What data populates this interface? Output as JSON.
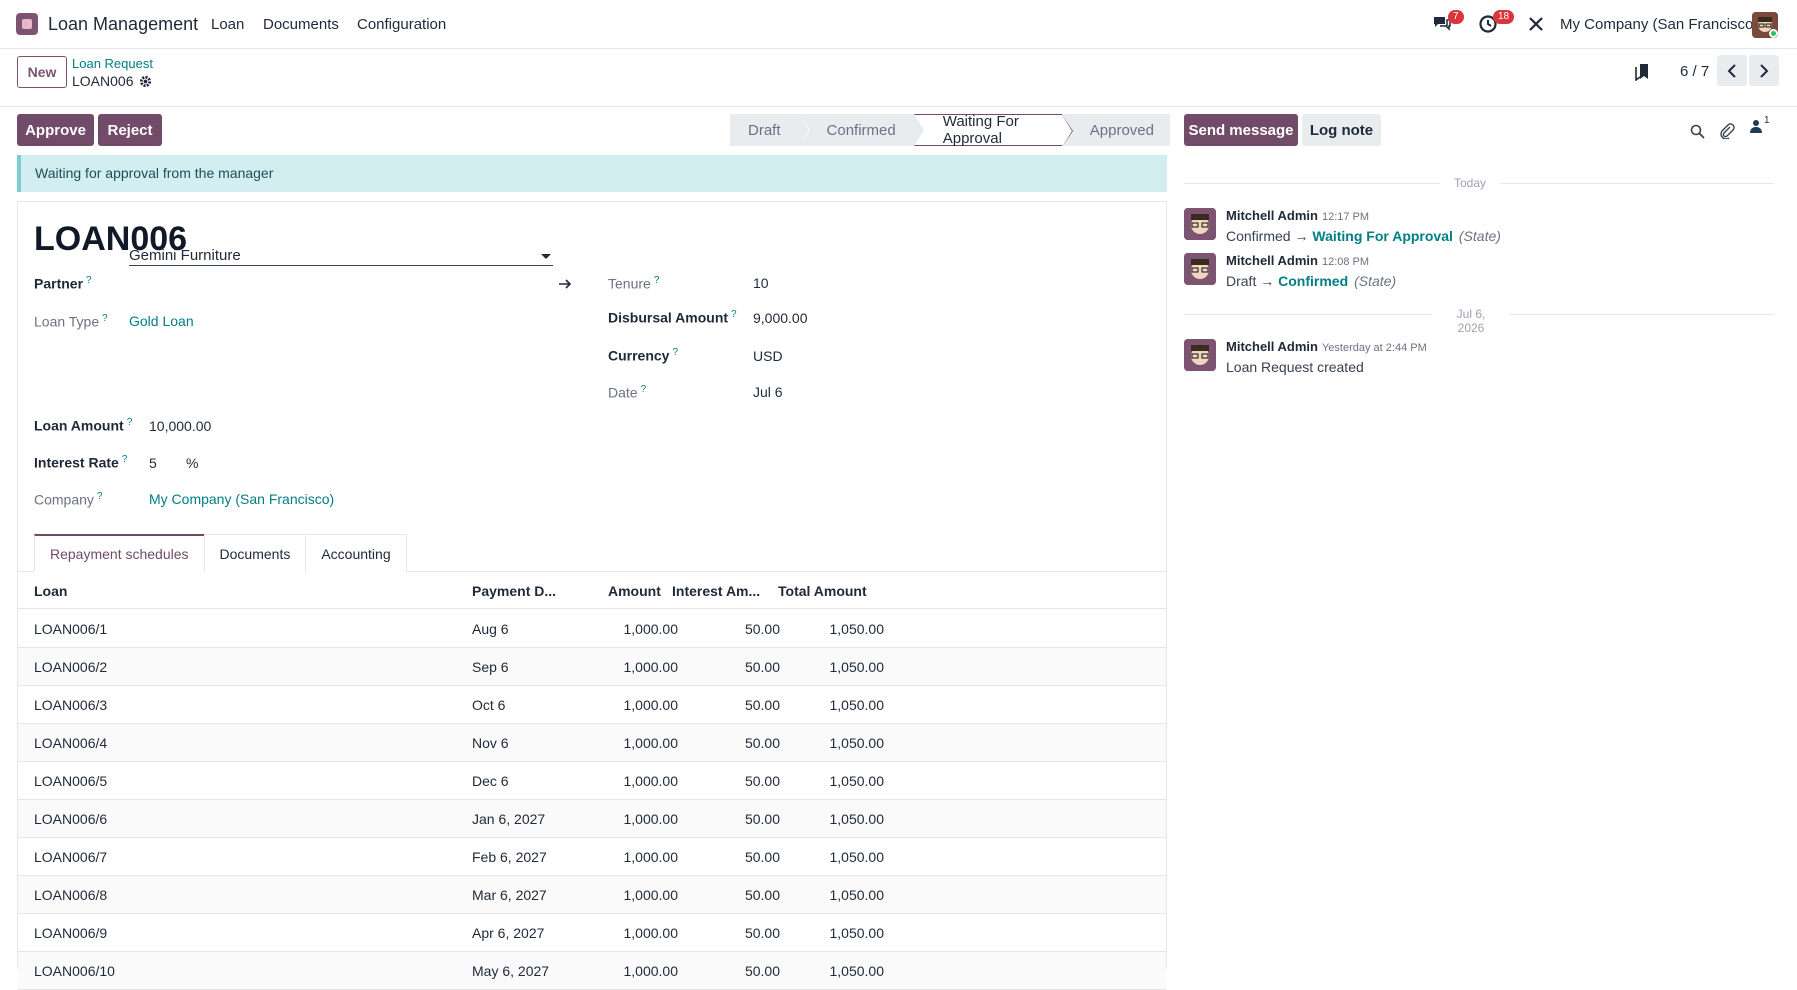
{
  "topbar": {
    "app_name": "Loan Management",
    "menu": [
      "Loan",
      "Documents",
      "Configuration"
    ],
    "messages_badge": "7",
    "activities_badge": "18",
    "company": "My Company (San Francisco)"
  },
  "control": {
    "new_label": "New",
    "breadcrumb_parent": "Loan Request",
    "breadcrumb_current": "LOAN006",
    "pager": "6 / 7"
  },
  "actions": {
    "approve": "Approve",
    "reject": "Reject",
    "stages": [
      "Draft",
      "Confirmed",
      "Waiting For Approval",
      "Approved"
    ],
    "active_stage": "Waiting For Approval"
  },
  "alert": "Waiting for approval from the manager",
  "form": {
    "title": "LOAN006",
    "partner_label": "Partner",
    "partner_value": "Gemini Furniture",
    "loan_type_label": "Loan Type",
    "loan_type_value": "Gold Loan",
    "tenure_label": "Tenure",
    "tenure_value": "10",
    "disbursal_label": "Disbursal Amount",
    "disbursal_value": "9,000.00",
    "currency_label": "Currency",
    "currency_value": "USD",
    "date_label": "Date",
    "date_value": "Jul 6",
    "loan_amount_label": "Loan Amount",
    "loan_amount_value": "10,000.00",
    "interest_rate_label": "Interest Rate",
    "interest_rate_value": "5",
    "interest_rate_unit": "%",
    "company_label": "Company",
    "company_value": "My Company (San Francisco)",
    "help_mark": "?"
  },
  "tabs": [
    "Repayment schedules",
    "Documents",
    "Accounting"
  ],
  "table": {
    "headers": [
      "Loan",
      "Payment D...",
      "Amount",
      "Interest Am...",
      "Total Amount"
    ],
    "rows": [
      [
        "LOAN006/1",
        "Aug 6",
        "1,000.00",
        "50.00",
        "1,050.00"
      ],
      [
        "LOAN006/2",
        "Sep 6",
        "1,000.00",
        "50.00",
        "1,050.00"
      ],
      [
        "LOAN006/3",
        "Oct 6",
        "1,000.00",
        "50.00",
        "1,050.00"
      ],
      [
        "LOAN006/4",
        "Nov 6",
        "1,000.00",
        "50.00",
        "1,050.00"
      ],
      [
        "LOAN006/5",
        "Dec 6",
        "1,000.00",
        "50.00",
        "1,050.00"
      ],
      [
        "LOAN006/6",
        "Jan 6, 2027",
        "1,000.00",
        "50.00",
        "1,050.00"
      ],
      [
        "LOAN006/7",
        "Feb 6, 2027",
        "1,000.00",
        "50.00",
        "1,050.00"
      ],
      [
        "LOAN006/8",
        "Mar 6, 2027",
        "1,000.00",
        "50.00",
        "1,050.00"
      ],
      [
        "LOAN006/9",
        "Apr 6, 2027",
        "1,000.00",
        "50.00",
        "1,050.00"
      ],
      [
        "LOAN006/10",
        "May 6, 2027",
        "1,000.00",
        "50.00",
        "1,050.00"
      ]
    ]
  },
  "chatter": {
    "send_message": "Send message",
    "log_note": "Log note",
    "followers_count": "1",
    "sep_today": "Today",
    "sep_date": "Jul 6, 2026",
    "messages": [
      {
        "author": "Mitchell Admin",
        "time": "12:17 PM",
        "from": "Confirmed",
        "arrow": "→",
        "to": "Waiting For Approval",
        "field": "(State)"
      },
      {
        "author": "Mitchell Admin",
        "time": "12:08 PM",
        "from": "Draft",
        "arrow": "→",
        "to": "Confirmed",
        "field": "(State)"
      },
      {
        "author": "Mitchell Admin",
        "time": "Yesterday at 2:44 PM",
        "body": "Loan Request created"
      }
    ]
  }
}
